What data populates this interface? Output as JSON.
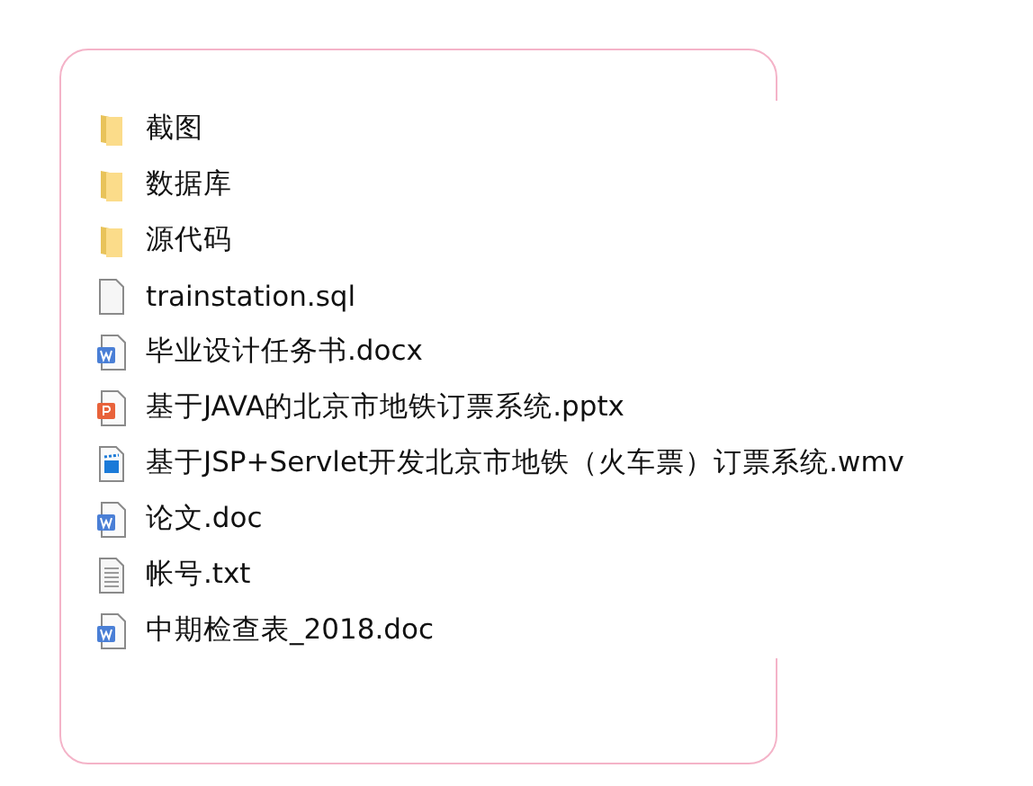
{
  "files": [
    {
      "kind": "folder",
      "name": "截图"
    },
    {
      "kind": "folder",
      "name": "数据库"
    },
    {
      "kind": "folder",
      "name": "源代码"
    },
    {
      "kind": "blank",
      "name": "trainstation.sql"
    },
    {
      "kind": "word",
      "name": "毕业设计任务书.docx"
    },
    {
      "kind": "ppt",
      "name": "基于JAVA的北京市地铁订票系统.pptx"
    },
    {
      "kind": "video",
      "name": "基于JSP+Servlet开发北京市地铁（火车票）订票系统.wmv"
    },
    {
      "kind": "word",
      "name": "论文.doc"
    },
    {
      "kind": "text",
      "name": "帐号.txt"
    },
    {
      "kind": "word",
      "name": "中期检查表_2018.doc"
    }
  ]
}
